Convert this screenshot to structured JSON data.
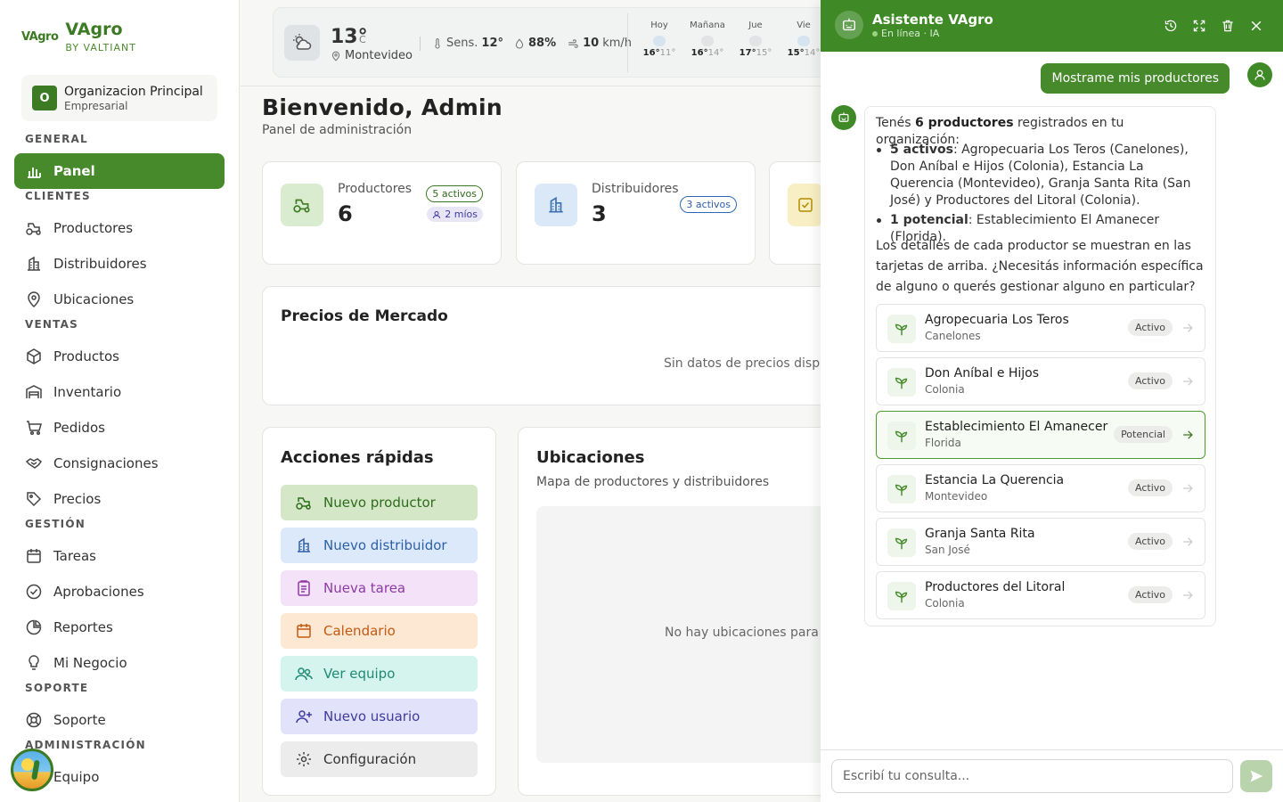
{
  "sidebar": {
    "brand_mark": "VAgro",
    "brand_name": "VAgro",
    "brand_sub": "BY VALTIANT",
    "org": {
      "initial": "O",
      "name": "Organizacion Principal",
      "type": "Empresarial"
    },
    "sections": {
      "general": "GENERAL",
      "clientes": "CLIENTES",
      "ventas": "VENTAS",
      "gestion": "GESTIÓN",
      "soporte": "SOPORTE",
      "administracion": "ADMINISTRACIÓN"
    },
    "items": {
      "panel": "Panel",
      "productores": "Productores",
      "distribuidores": "Distribuidores",
      "ubicaciones": "Ubicaciones",
      "productos": "Productos",
      "inventario": "Inventario",
      "pedidos": "Pedidos",
      "consignaciones": "Consignaciones",
      "precios": "Precios",
      "tareas": "Tareas",
      "aprobaciones": "Aprobaciones",
      "reportes": "Reportes",
      "mi_negocio": "Mi Negocio",
      "soporte": "Soporte",
      "equipo": "Equipo"
    }
  },
  "weather": {
    "temp": "13°",
    "unit": "C",
    "city": "Montevideo",
    "feels_label": "Sens.",
    "feels": "12°",
    "humidity": "88%",
    "wind": "10",
    "wind_unit": "km/h",
    "forecast": [
      {
        "day": "Hoy",
        "max": "16°",
        "min": "11°"
      },
      {
        "day": "Mañana",
        "max": "16°",
        "min": "14°"
      },
      {
        "day": "Jue",
        "max": "17°",
        "min": "15°"
      },
      {
        "day": "Vie",
        "max": "15°",
        "min": "14°"
      }
    ]
  },
  "main": {
    "welcome": "Bienvenido, Admin",
    "welcome_sub": "Panel de administración",
    "stats": {
      "productores": {
        "label": "Productores",
        "value": "6",
        "badge_active": "5 activos",
        "badge_mine": "2 míos"
      },
      "distribuidores": {
        "label": "Distribuidores",
        "value": "3",
        "badge_active": "3 activos"
      }
    },
    "market": {
      "title": "Precios de Mercado",
      "empty": "Sin datos de precios disponibles"
    },
    "quick": {
      "title": "Acciones rápidas",
      "nuevo_productor": "Nuevo productor",
      "nuevo_distribuidor": "Nuevo distribuidor",
      "nueva_tarea": "Nueva tarea",
      "calendario": "Calendario",
      "ver_equipo": "Ver equipo",
      "nuevo_usuario": "Nuevo usuario",
      "configuracion": "Configuración"
    },
    "locations": {
      "title": "Ubicaciones",
      "subtitle": "Mapa de productores y distribuidores",
      "empty": "No hay ubicaciones para mostrar"
    }
  },
  "chat": {
    "title": "Asistente VAgro",
    "status": "En línea · IA",
    "user_message": "Mostrame mis productores",
    "reply": {
      "intro_pre": "Tenés ",
      "intro_bold": "6 productores",
      "intro_post": " registrados en tu organización:",
      "bullet1_bold": "5 activos",
      "bullet1_text": ": Agropecuaria Los Teros (Canelones), Don Aníbal e Hijos (Colonia), Estancia La Querencia (Montevideo), Granja Santa Rita (San José) y Productores del Litoral (Colonia).",
      "bullet2_bold": "1 potencial",
      "bullet2_text": ": Establecimiento El Amanecer (Florida).",
      "outro": "Los detalles de cada productor se muestran en las tarjetas de arriba. ¿Necesitás información específica de alguno o querés gestionar alguno en particular?"
    },
    "producers": [
      {
        "name": "Agropecuaria Los Teros",
        "location": "Canelones",
        "status": "Activo"
      },
      {
        "name": "Don Aníbal e Hijos",
        "location": "Colonia",
        "status": "Activo"
      },
      {
        "name": "Establecimiento El Amanecer",
        "location": "Florida",
        "status": "Potencial"
      },
      {
        "name": "Estancia La Querencia",
        "location": "Montevideo",
        "status": "Activo"
      },
      {
        "name": "Granja Santa Rita",
        "location": "San José",
        "status": "Activo"
      },
      {
        "name": "Productores del Litoral",
        "location": "Colonia",
        "status": "Activo"
      }
    ],
    "input_placeholder": "Escribí tu consulta..."
  }
}
